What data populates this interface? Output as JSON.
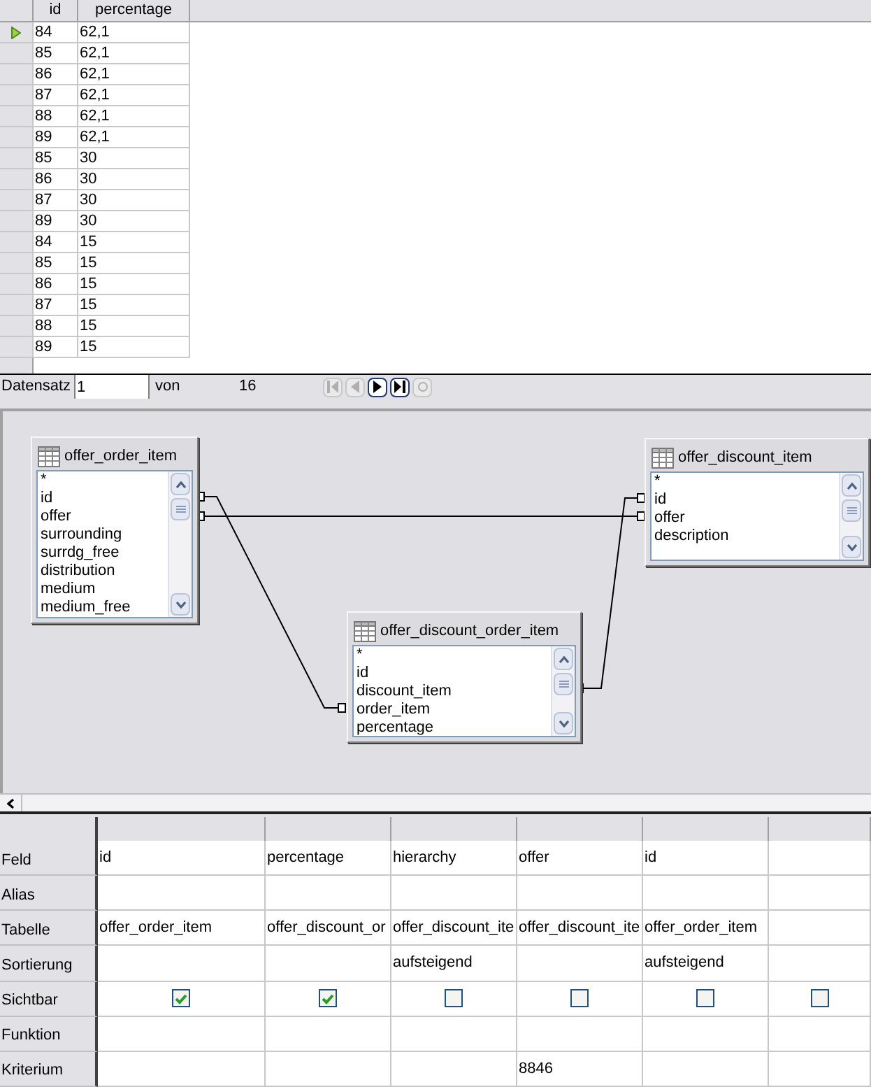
{
  "result_grid": {
    "columns": [
      "id",
      "percentage"
    ],
    "rows": [
      {
        "cells": [
          "84",
          "62,1"
        ],
        "current": true
      },
      {
        "cells": [
          "85",
          "62,1"
        ],
        "current": false
      },
      {
        "cells": [
          "86",
          "62,1"
        ],
        "current": false
      },
      {
        "cells": [
          "87",
          "62,1"
        ],
        "current": false
      },
      {
        "cells": [
          "88",
          "62,1"
        ],
        "current": false
      },
      {
        "cells": [
          "89",
          "62,1"
        ],
        "current": false
      },
      {
        "cells": [
          "85",
          "30"
        ],
        "current": false
      },
      {
        "cells": [
          "86",
          "30"
        ],
        "current": false
      },
      {
        "cells": [
          "87",
          "30"
        ],
        "current": false
      },
      {
        "cells": [
          "89",
          "30"
        ],
        "current": false
      },
      {
        "cells": [
          "84",
          "15"
        ],
        "current": false
      },
      {
        "cells": [
          "85",
          "15"
        ],
        "current": false
      },
      {
        "cells": [
          "86",
          "15"
        ],
        "current": false
      },
      {
        "cells": [
          "87",
          "15"
        ],
        "current": false
      },
      {
        "cells": [
          "88",
          "15"
        ],
        "current": false
      },
      {
        "cells": [
          "89",
          "15"
        ],
        "current": false
      }
    ]
  },
  "navigator": {
    "label": "Datensatz",
    "record": "1",
    "of_label": "von",
    "total": "16",
    "buttons": [
      {
        "kind": "first",
        "disabled": true
      },
      {
        "kind": "previous",
        "disabled": true
      },
      {
        "kind": "next",
        "disabled": false
      },
      {
        "kind": "last",
        "disabled": false
      },
      {
        "kind": "new",
        "disabled": true
      }
    ]
  },
  "diagram": {
    "tables": [
      {
        "title": "offer_order_item",
        "fields": [
          "*",
          "id",
          "offer",
          "surrounding",
          "surrdg_free",
          "distribution",
          "medium",
          "medium_free"
        ]
      },
      {
        "title": "offer_discount_item",
        "fields": [
          "*",
          "id",
          "offer",
          "description"
        ]
      },
      {
        "title": "offer_discount_order_item",
        "fields": [
          "*",
          "id",
          "discount_item",
          "order_item",
          "percentage"
        ]
      }
    ]
  },
  "design_grid": {
    "rows": [
      {
        "label": "Feld",
        "kind": "field"
      },
      {
        "label": "Alias",
        "kind": "alias"
      },
      {
        "label": "Tabelle",
        "kind": "table"
      },
      {
        "label": "Sortierung",
        "kind": "sort"
      },
      {
        "label": "Sichtbar",
        "kind": "visible"
      },
      {
        "label": "Funktion",
        "kind": "function"
      },
      {
        "label": "Kriterium",
        "kind": "criterion"
      }
    ],
    "columns": [
      {
        "field": "id",
        "table": "offer_order_item",
        "visible": true
      },
      {
        "field": "percentage",
        "table": "offer_discount_or",
        "visible": true
      },
      {
        "field": "hierarchy",
        "table": "offer_discount_ite",
        "sort": "aufsteigend",
        "visible": false
      },
      {
        "field": "offer",
        "table": "offer_discount_ite",
        "visible": false,
        "criterion": "8846"
      },
      {
        "field": "id",
        "table": "offer_order_item",
        "sort": "aufsteigend",
        "visible": false
      },
      {
        "visible": false
      }
    ]
  }
}
